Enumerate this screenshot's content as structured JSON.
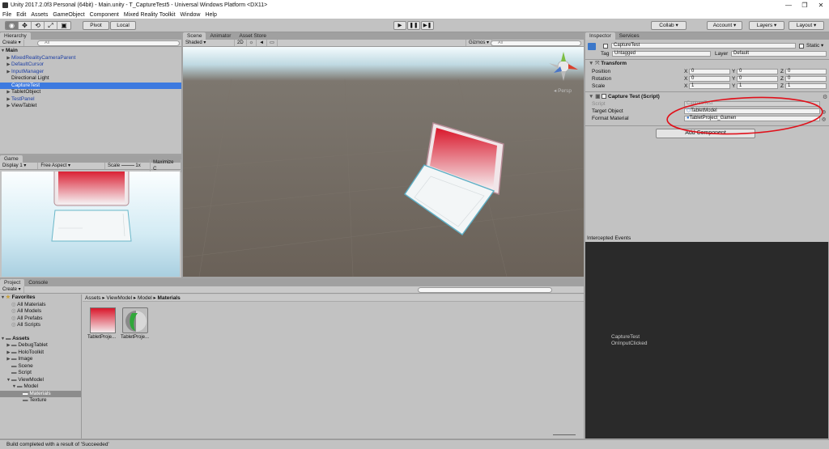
{
  "window": {
    "title": "Unity 2017.2.0f3 Personal (64bit) - Main.unity - T_CaptureTest5 - Universal Windows Platform <DX11>",
    "minimize": "—",
    "maximize": "❐",
    "close": "✕"
  },
  "menu": [
    "File",
    "Edit",
    "Assets",
    "GameObject",
    "Component",
    "Mixed Reality Toolkit",
    "Window",
    "Help"
  ],
  "toolbar": {
    "pivot": "Pivot",
    "local": "Local",
    "play": "▶",
    "pause": "❚❚",
    "step": "▶❚",
    "collab": "Collab ▾",
    "account": "Account ▾",
    "layers": "Layers ▾",
    "layout": "Layout ▾",
    "transform_tools": [
      "◉",
      "✥",
      "⟲",
      "⤢",
      "▣"
    ]
  },
  "hierarchy": {
    "tab": "Hierarchy",
    "create": "Create ▾",
    "search_placeholder": "All",
    "scene_name": "Main",
    "items": [
      {
        "label": "MixedRealityCameraParent",
        "arrow": "▶",
        "blue": true
      },
      {
        "label": "DefaultCursor",
        "arrow": "▶",
        "blue": true
      },
      {
        "label": "InputManager",
        "arrow": "▶",
        "blue": true
      },
      {
        "label": "Directional Light",
        "arrow": "",
        "blue": false
      },
      {
        "label": "CaptureTest",
        "arrow": "",
        "blue": false,
        "selected": true
      },
      {
        "label": "TabletObject",
        "arrow": "▶",
        "blue": false
      },
      {
        "label": "TestPanel",
        "arrow": "▶",
        "blue": true
      },
      {
        "label": "ViewTablet",
        "arrow": "▶",
        "blue": false
      }
    ]
  },
  "scene": {
    "tabs": [
      "Scene",
      "Animator",
      "Asset Store"
    ],
    "shaded": "Shaded ▾",
    "mode2d": "2D",
    "gizmos": "Gizmos ▾",
    "search_placeholder": "All",
    "persp": "◂ Persp"
  },
  "game": {
    "tab": "Game",
    "display": "Display 1 ▾",
    "aspect": "Free Aspect ▾",
    "scale_label": "Scale",
    "scale_value": "1x",
    "maximize": "Maximize C"
  },
  "inspector": {
    "tabs": [
      "Inspector",
      "Services"
    ],
    "object_name": "CaptureTest",
    "static_label": "Static ▾",
    "tag_label": "Tag",
    "tag_value": "Untagged",
    "layer_label": "Layer",
    "layer_value": "Default",
    "transform_title": "Transform",
    "rows": [
      {
        "label": "Position",
        "x": "0",
        "y": "0",
        "z": "0"
      },
      {
        "label": "Rotation",
        "x": "0",
        "y": "0",
        "z": "0"
      },
      {
        "label": "Scale",
        "x": "1",
        "y": "1",
        "z": "1"
      }
    ],
    "axis": [
      "X",
      "Y",
      "Z"
    ],
    "script_title": "Capture Test (Script)",
    "script_label": "Script",
    "script_value": "CaptureTest",
    "target_label": "Target Object",
    "target_value": "TabletModel",
    "format_label": "Format Material",
    "format_value": "TabletProject_Gamen",
    "add_component": "Add Component"
  },
  "events": {
    "title": "Intercepted Events",
    "line1": "CaptureTest",
    "line2": "OnInputClicked"
  },
  "project": {
    "tabs": [
      "Project",
      "Console"
    ],
    "create": "Create ▾",
    "favorites_title": "Favorites",
    "favorites": [
      "All Materials",
      "All Models",
      "All Prefabs",
      "All Scripts"
    ],
    "assets_title": "Assets",
    "assets": [
      {
        "label": "DebugTablet",
        "indent": 1,
        "arrow": "▶"
      },
      {
        "label": "HoloToolkit",
        "indent": 1,
        "arrow": "▶"
      },
      {
        "label": "Image",
        "indent": 1,
        "arrow": "▶"
      },
      {
        "label": "Scene",
        "indent": 1,
        "arrow": ""
      },
      {
        "label": "Script",
        "indent": 1,
        "arrow": ""
      },
      {
        "label": "ViewModel",
        "indent": 1,
        "arrow": "▼"
      },
      {
        "label": "Model",
        "indent": 2,
        "arrow": "▼"
      },
      {
        "label": "Materials",
        "indent": 3,
        "arrow": "",
        "selected": true
      },
      {
        "label": "Texture",
        "indent": 3,
        "arrow": ""
      }
    ],
    "breadcrumb": [
      "Assets",
      "ViewModel",
      "Model",
      "Materials"
    ],
    "files": [
      "TabletProje...",
      "TabletProje..."
    ]
  },
  "status": {
    "text": "Build completed with a result of 'Succeeded'"
  },
  "colors": {
    "selection": "#3d7ae0",
    "annotation": "#e0111b",
    "tablet_red": "#d9172b"
  }
}
